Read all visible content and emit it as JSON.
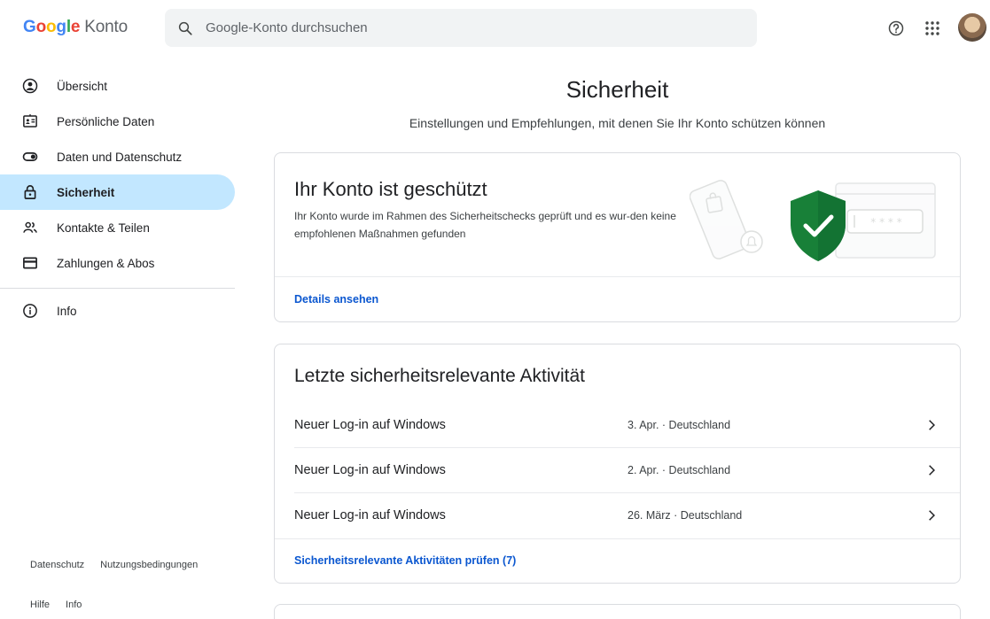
{
  "header": {
    "logo_letters": [
      {
        "ch": "G",
        "color": "#4285F4"
      },
      {
        "ch": "o",
        "color": "#EA4335"
      },
      {
        "ch": "o",
        "color": "#FBBC05"
      },
      {
        "ch": "g",
        "color": "#4285F4"
      },
      {
        "ch": "l",
        "color": "#34A853"
      },
      {
        "ch": "e",
        "color": "#EA4335"
      }
    ],
    "logo_suffix": "Konto",
    "search_placeholder": "Google-Konto durchsuchen"
  },
  "sidebar": {
    "items": [
      {
        "label": "Übersicht",
        "icon": "account-circle-icon"
      },
      {
        "label": "Persönliche Daten",
        "icon": "id-card-icon"
      },
      {
        "label": "Daten und Datenschutz",
        "icon": "toggle-icon"
      },
      {
        "label": "Sicherheit",
        "icon": "lock-icon",
        "active": true
      },
      {
        "label": "Kontakte & Teilen",
        "icon": "people-icon"
      },
      {
        "label": "Zahlungen & Abos",
        "icon": "credit-card-icon"
      }
    ],
    "info_item": {
      "label": "Info",
      "icon": "info-icon"
    },
    "footer_row1": [
      "Datenschutz",
      "Nutzungsbedingungen"
    ],
    "footer_row2": [
      "Hilfe",
      "Info"
    ]
  },
  "main": {
    "title": "Sicherheit",
    "subtitle": "Einstellungen und Empfehlungen, mit denen Sie Ihr Konto schützen können",
    "status_card": {
      "title": "Ihr Konto ist geschützt",
      "description": "Ihr Konto wurde im Rahmen des Sicherheitschecks geprüft und es wur-den keine empfohlenen Maßnahmen gefunden",
      "link": "Details ansehen",
      "password_mask": "* * * *"
    },
    "activity_card": {
      "title": "Letzte sicherheitsrelevante Aktivität",
      "rows": [
        {
          "event": "Neuer Log-in auf Windows",
          "detail": "3. Apr. · Deutschland"
        },
        {
          "event": "Neuer Log-in auf Windows",
          "detail": "2. Apr. · Deutschland"
        },
        {
          "event": "Neuer Log-in auf Windows",
          "detail": "26. März · Deutschland"
        }
      ],
      "link": "Sicherheitsrelevante Aktivitäten prüfen (7)"
    }
  },
  "colors": {
    "active_nav": "#c2e7ff",
    "link": "#0b57d0",
    "shield_green": "#188038"
  }
}
